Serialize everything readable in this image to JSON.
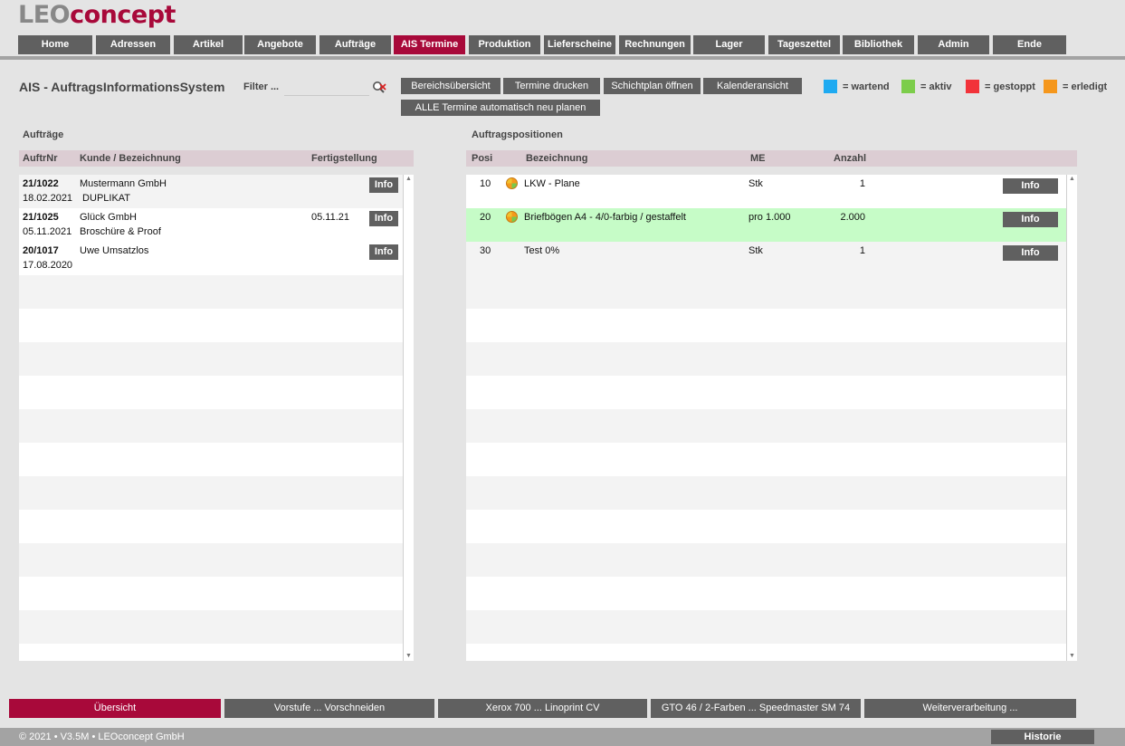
{
  "logo": {
    "part1": "LEO",
    "part2": "concept"
  },
  "nav": [
    {
      "label": "Home"
    },
    {
      "label": "Adressen"
    },
    {
      "label": "Artikel"
    },
    {
      "label": "Angebote"
    },
    {
      "label": "Aufträge"
    },
    {
      "label": "AIS Termine"
    },
    {
      "label": "Produktion"
    },
    {
      "label": "Lieferscheine"
    },
    {
      "label": "Rechnungen"
    },
    {
      "label": "Lager"
    },
    {
      "label": "Tageszettel"
    },
    {
      "label": "Bibliothek"
    },
    {
      "label": "Admin"
    },
    {
      "label": "Ende"
    }
  ],
  "page_title": "AIS - AuftragsInformationsSystem",
  "filter": {
    "label": "Filter ...",
    "value": "",
    "icon": "search-clear-icon"
  },
  "actions": {
    "overview": "Bereichsübersicht",
    "print": "Termine drucken",
    "shiftplan": "Schichtplan öffnen",
    "calendar": "Kalenderansicht",
    "replan": "ALLE Termine automatisch neu planen"
  },
  "legend": [
    {
      "label": "= wartend",
      "color": "#1eaaf1"
    },
    {
      "label": "= aktiv",
      "color": "#7ccd4b"
    },
    {
      "label": "= gestoppt",
      "color": "#f2333a"
    },
    {
      "label": "= erledigt",
      "color": "#f5971c"
    }
  ],
  "orders": {
    "title": "Aufträge",
    "columns": {
      "nr": "AuftrNr",
      "customer": "Kunde / Bezeichnung",
      "finish": "Fertigstellung"
    },
    "rows": [
      {
        "nr": "21/1022",
        "date": "18.02.2021",
        "customer": "Mustermann GmbH",
        "desc": " DUPLIKAT",
        "finish": "",
        "info": "Info"
      },
      {
        "nr": "21/1025",
        "date": "05.11.2021",
        "customer": "Glück GmbH",
        "desc": "Broschüre & Proof",
        "finish": "05.11.21",
        "info": "Info"
      },
      {
        "nr": "20/1017",
        "date": "17.08.2020",
        "customer": "Uwe Umsatzlos",
        "desc": "",
        "finish": "",
        "info": "Info"
      }
    ]
  },
  "positions": {
    "title": "Auftragspositionen",
    "columns": {
      "pos": "Posi",
      "name": "Bezeichnung",
      "unit": "ME",
      "qty": "Anzahl"
    },
    "rows": [
      {
        "pos": "10",
        "name": "LKW - Plane",
        "unit": "Stk",
        "qty": "1",
        "info": "Info"
      },
      {
        "pos": "20",
        "name": "Briefbögen A4 - 4/0-farbig / gestaffelt",
        "unit": "pro 1.000",
        "qty": "2.000",
        "info": "Info"
      },
      {
        "pos": "30",
        "name": "Test 0%",
        "unit": "Stk",
        "qty": "1",
        "info": "Info"
      }
    ]
  },
  "bottom_tabs": [
    {
      "label": "Übersicht"
    },
    {
      "label": "Vorstufe ... Vorschneiden"
    },
    {
      "label": "Xerox 700 ... Linoprint CV"
    },
    {
      "label": "GTO 46 / 2-Farben ... Speedmaster SM 74"
    },
    {
      "label": "Weiterverarbeitung ..."
    }
  ],
  "footer": {
    "copyright": "© 2021 • V3.5M • LEOconcept GmbH",
    "history": "Historie"
  },
  "colors": {
    "accent": "#a8093a",
    "button": "#606060",
    "highlight_row": "#c6fcc7"
  }
}
